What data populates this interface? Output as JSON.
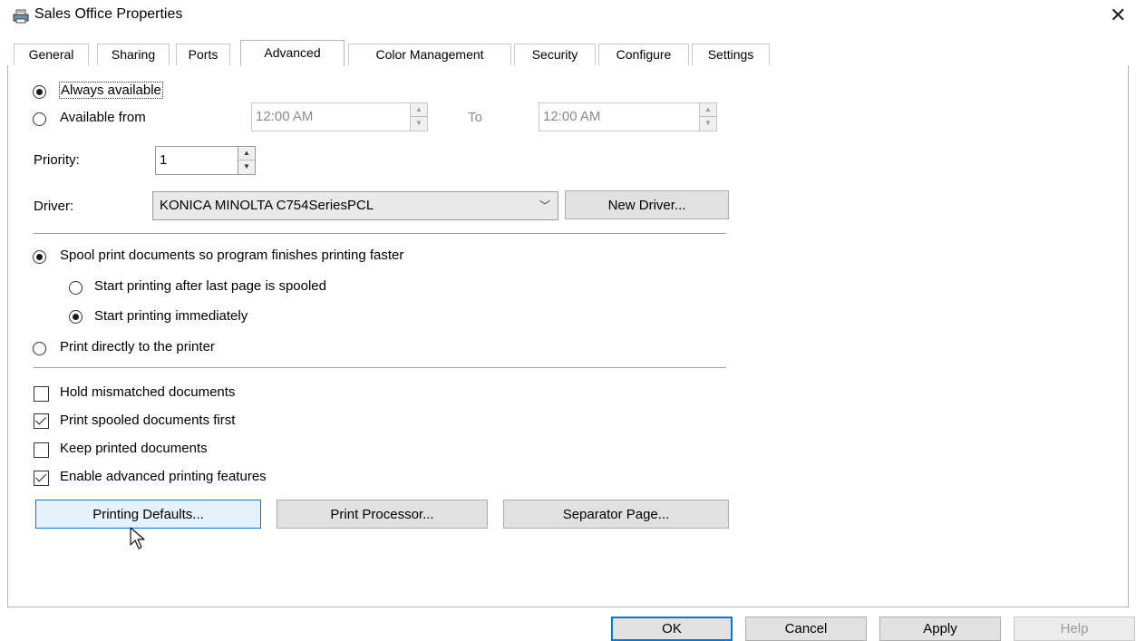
{
  "window": {
    "title": "Sales Office Properties",
    "icon": "printer-icon",
    "close_glyph": "✕"
  },
  "tabs": [
    {
      "label": "General"
    },
    {
      "label": "Sharing"
    },
    {
      "label": "Ports"
    },
    {
      "label": "Advanced",
      "active": true
    },
    {
      "label": "Color Management"
    },
    {
      "label": "Security"
    },
    {
      "label": "Configure"
    },
    {
      "label": "Settings"
    }
  ],
  "availability": {
    "always_label": "Always available",
    "from_label": "Available from",
    "from_time": "12:00 AM",
    "to_label": "To",
    "to_time": "12:00 AM",
    "selected": "always"
  },
  "priority": {
    "label": "Priority:",
    "value": "1"
  },
  "driver": {
    "label": "Driver:",
    "value": "KONICA MINOLTA C754SeriesPCL",
    "new_driver_button": "New Driver..."
  },
  "spooling": {
    "spool_label": "Spool print documents so program finishes printing faster",
    "after_last_page_label": "Start printing after last page is spooled",
    "immediately_label": "Start printing immediately",
    "direct_label": "Print directly to the printer"
  },
  "options": {
    "hold_mismatched": {
      "label": "Hold mismatched documents",
      "checked": false
    },
    "spooled_first": {
      "label": "Print spooled documents first",
      "checked": true
    },
    "keep_printed": {
      "label": "Keep printed documents",
      "checked": false
    },
    "advanced_features": {
      "label": "Enable advanced printing features",
      "checked": true
    }
  },
  "action_buttons": {
    "printing_defaults": "Printing Defaults...",
    "print_processor": "Print Processor...",
    "separator_page": "Separator Page..."
  },
  "footer": {
    "ok": "OK",
    "cancel": "Cancel",
    "apply": "Apply",
    "help": "Help"
  },
  "colors": {
    "accent": "#0078d7",
    "disabled_text": "#8a8a8a"
  }
}
